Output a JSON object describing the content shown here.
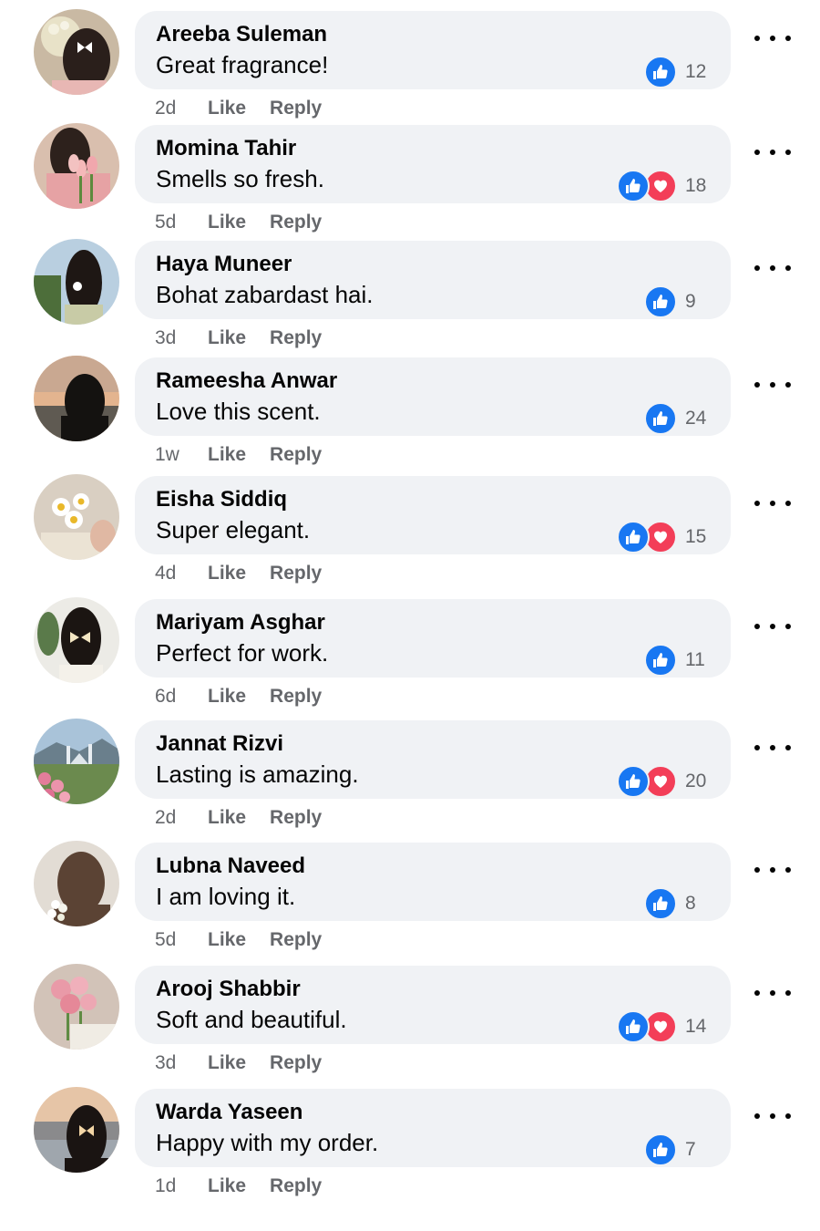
{
  "colors": {
    "like": "#1877f2",
    "love": "#f33e58",
    "bubble": "#f0f2f5",
    "meta": "#65676b"
  },
  "actions": {
    "like": "Like",
    "reply": "Reply"
  },
  "comments": [
    {
      "author": "Areeba Suleman",
      "text": "Great fragrance!",
      "time": "2d",
      "reactions": [
        "like-icon"
      ],
      "count": "12",
      "avatar": "white-bow-hair-flowers"
    },
    {
      "author": "Momina Tahir",
      "text": "Smells so fresh.",
      "time": "5d",
      "reactions": [
        "like-icon",
        "love-icon"
      ],
      "count": "18",
      "avatar": "pink-tulips"
    },
    {
      "author": "Haya Muneer",
      "text": "Bohat zabardast hai.",
      "time": "3d",
      "reactions": [
        "like-icon"
      ],
      "count": "9",
      "avatar": "girl-hair-flower"
    },
    {
      "author": "Rameesha Anwar",
      "text": "Love this scent.",
      "time": "1w",
      "reactions": [
        "like-icon"
      ],
      "count": "24",
      "avatar": "hijab-sunset"
    },
    {
      "author": "Eisha Siddiq",
      "text": "Super elegant.",
      "time": "4d",
      "reactions": [
        "like-icon",
        "love-icon"
      ],
      "count": "15",
      "avatar": "daisies"
    },
    {
      "author": "Mariyam Asghar",
      "text": "Perfect for work.",
      "time": "6d",
      "reactions": [
        "like-icon"
      ],
      "count": "11",
      "avatar": "cream-bow-hair"
    },
    {
      "author": "Jannat Rizvi",
      "text": "Lasting is amazing.",
      "time": "2d",
      "reactions": [
        "like-icon",
        "love-icon"
      ],
      "count": "20",
      "avatar": "mosque-roses"
    },
    {
      "author": "Lubna Naveed",
      "text": "I am loving it.",
      "time": "5d",
      "reactions": [
        "like-icon"
      ],
      "count": "8",
      "avatar": "brown-hijab-flowers"
    },
    {
      "author": "Arooj Shabbir",
      "text": "Soft and beautiful.",
      "time": "3d",
      "reactions": [
        "like-icon",
        "love-icon"
      ],
      "count": "14",
      "avatar": "pink-roses-bouquet"
    },
    {
      "author": "Warda Yaseen",
      "text": "Happy with my order.",
      "time": "1d",
      "reactions": [
        "like-icon"
      ],
      "count": "7",
      "avatar": "butterfly-clip-lake"
    }
  ]
}
